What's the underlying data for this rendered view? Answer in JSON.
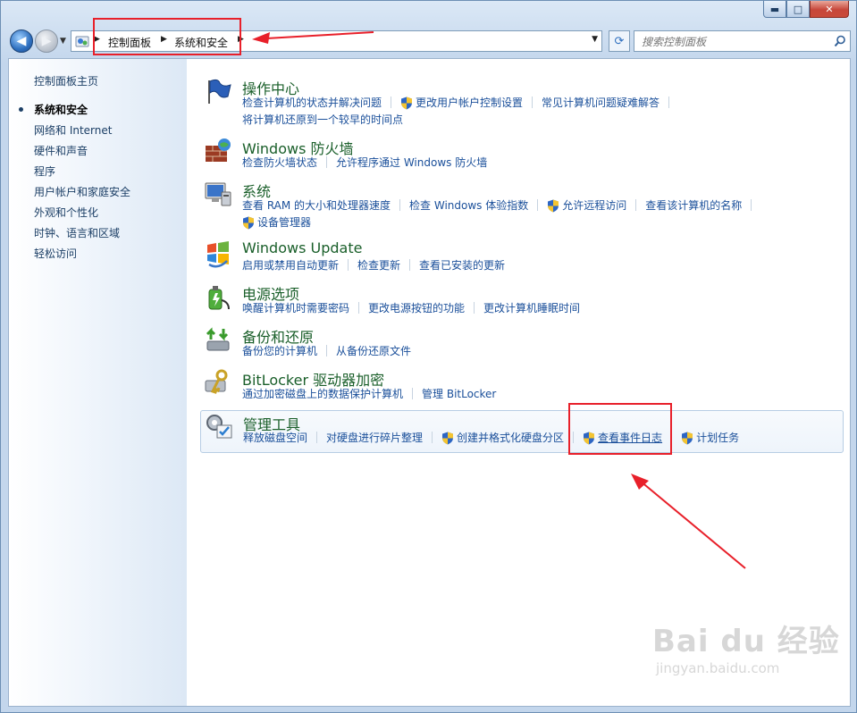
{
  "window": {
    "buttons": {
      "minimize": "▬",
      "maximize": "□",
      "close": "✕"
    }
  },
  "navbar": {
    "breadcrumbs": [
      "控制面板",
      "系统和安全"
    ],
    "search_placeholder": "搜索控制面板"
  },
  "sidebar": {
    "items": [
      {
        "label": "控制面板主页",
        "current": false
      },
      {
        "label": "系统和安全",
        "current": true
      },
      {
        "label": "网络和 Internet",
        "current": false
      },
      {
        "label": "硬件和声音",
        "current": false
      },
      {
        "label": "程序",
        "current": false
      },
      {
        "label": "用户帐户和家庭安全",
        "current": false
      },
      {
        "label": "外观和个性化",
        "current": false
      },
      {
        "label": "时钟、语言和区域",
        "current": false
      },
      {
        "label": "轻松访问",
        "current": false
      }
    ]
  },
  "categories": [
    {
      "title": "操作中心",
      "icon": "action-center-flag-icon",
      "links": [
        {
          "label": "检查计算机的状态并解决问题",
          "shield": false
        },
        {
          "label": "更改用户帐户控制设置",
          "shield": true
        },
        {
          "label": "常见计算机问题疑难解答",
          "shield": false
        },
        {
          "label": "将计算机还原到一个较早的时间点",
          "shield": false
        }
      ]
    },
    {
      "title": "Windows 防火墙",
      "icon": "firewall-icon",
      "links": [
        {
          "label": "检查防火墙状态",
          "shield": false
        },
        {
          "label": "允许程序通过 Windows 防火墙",
          "shield": false
        }
      ]
    },
    {
      "title": "系统",
      "icon": "system-computer-icon",
      "links": [
        {
          "label": "查看 RAM 的大小和处理器速度",
          "shield": false
        },
        {
          "label": "检查 Windows 体验指数",
          "shield": false
        },
        {
          "label": "允许远程访问",
          "shield": true
        },
        {
          "label": "查看该计算机的名称",
          "shield": false
        },
        {
          "label": "设备管理器",
          "shield": true
        }
      ]
    },
    {
      "title": "Windows Update",
      "icon": "windows-update-icon",
      "links": [
        {
          "label": "启用或禁用自动更新",
          "shield": false
        },
        {
          "label": "检查更新",
          "shield": false
        },
        {
          "label": "查看已安装的更新",
          "shield": false
        }
      ]
    },
    {
      "title": "电源选项",
      "icon": "power-options-icon",
      "links": [
        {
          "label": "唤醒计算机时需要密码",
          "shield": false
        },
        {
          "label": "更改电源按钮的功能",
          "shield": false
        },
        {
          "label": "更改计算机睡眠时间",
          "shield": false
        }
      ]
    },
    {
      "title": "备份和还原",
      "icon": "backup-restore-icon",
      "links": [
        {
          "label": "备份您的计算机",
          "shield": false
        },
        {
          "label": "从备份还原文件",
          "shield": false
        }
      ]
    },
    {
      "title": "BitLocker 驱动器加密",
      "icon": "bitlocker-icon",
      "links": [
        {
          "label": "通过加密磁盘上的数据保护计算机",
          "shield": false
        },
        {
          "label": "管理 BitLocker",
          "shield": false
        }
      ]
    },
    {
      "title": "管理工具",
      "icon": "admin-tools-icon",
      "links": [
        {
          "label": "释放磁盘空间",
          "shield": false
        },
        {
          "label": "对硬盘进行碎片整理",
          "shield": false
        },
        {
          "label": "创建并格式化硬盘分区",
          "shield": true
        },
        {
          "label": "查看事件日志",
          "shield": true
        },
        {
          "label": "计划任务",
          "shield": true
        }
      ]
    }
  ],
  "watermark": {
    "brand": "Bai du 经验",
    "url": "jingyan.baidu.com"
  },
  "colors": {
    "link": "#1a4f9a",
    "category_title": "#1a5f2a",
    "annotation": "#e8202a"
  }
}
